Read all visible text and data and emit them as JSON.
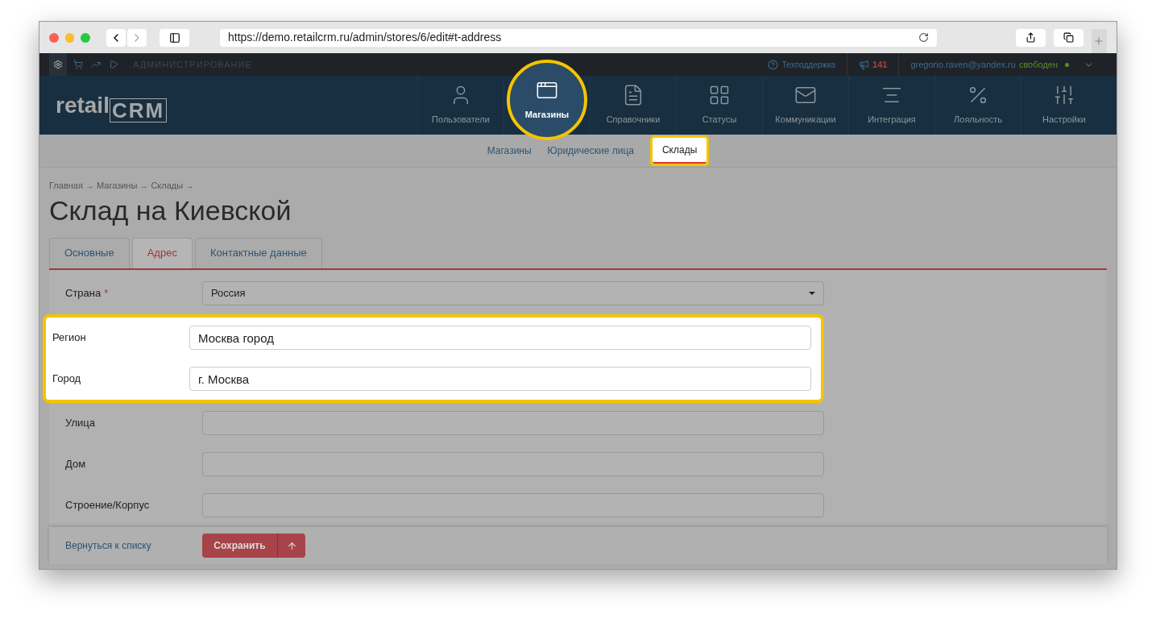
{
  "browser": {
    "url": "https://demo.retailcrm.ru/admin/stores/6/edit#t-address"
  },
  "admin_bar": {
    "section": "АДМИНИСТРИРОВАНИЕ",
    "support": "Техподдержка",
    "notifications": "141",
    "user_email": "gregorio.raven@yandex.ru",
    "user_status": "свободен"
  },
  "logo": {
    "prefix": "retail",
    "mark": "CRM"
  },
  "nav": [
    {
      "label": "Пользователи",
      "selected": false
    },
    {
      "label": "Магазины",
      "selected": true
    },
    {
      "label": "Справочники",
      "selected": false
    },
    {
      "label": "Статусы",
      "selected": false
    },
    {
      "label": "Коммуникации",
      "selected": false
    },
    {
      "label": "Интеграция",
      "selected": false
    },
    {
      "label": "Лояльность",
      "selected": false
    },
    {
      "label": "Настройки",
      "selected": false
    }
  ],
  "subnav": [
    {
      "label": "Магазины",
      "selected": false
    },
    {
      "label": "Юридические лица",
      "selected": false
    },
    {
      "label": "Склады",
      "selected": true
    }
  ],
  "breadcrumb": "Главная → Магазины → Склады →",
  "title": "Склад на Киевской",
  "tabs": [
    {
      "label": "Основные",
      "selected": false
    },
    {
      "label": "Адрес",
      "selected": true
    },
    {
      "label": "Контактные данные",
      "selected": false
    }
  ],
  "fields": [
    {
      "label": "Страна",
      "required_mark": "*",
      "kind": "select",
      "value": "Россия",
      "highlighted": false
    },
    {
      "label": "Регион",
      "kind": "text",
      "value": "Москва город",
      "highlighted": true
    },
    {
      "label": "Город",
      "kind": "text",
      "value": "г. Москва",
      "highlighted": true
    },
    {
      "label": "Улица",
      "kind": "text",
      "highlighted": false
    },
    {
      "label": "Дом",
      "kind": "text",
      "highlighted": false
    },
    {
      "label": "Строение/Корпус",
      "kind": "text",
      "highlighted": false
    }
  ],
  "footer": {
    "back_link": "Вернуться к списку",
    "save_button": "Сохранить"
  }
}
